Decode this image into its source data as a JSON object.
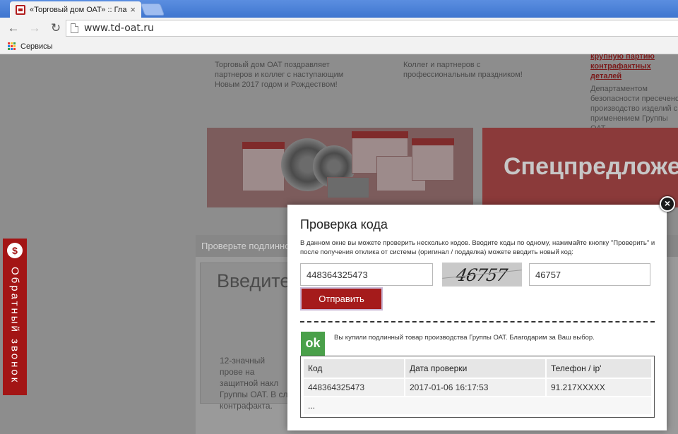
{
  "browser": {
    "tab_title": "«Торговый дом ОАТ» :: Гла",
    "tab_close": "×",
    "url": "www.td-oat.ru",
    "bookmarks_label": "Сервисы"
  },
  "background": {
    "news": [
      {
        "link": "",
        "text": "Торговый дом ОАТ поздравляет партнеров и коллег с наступающим Новым 2017 годом и Рождеством!"
      },
      {
        "link": "",
        "text": "Коллег и партнеров с профессиональным праздником!"
      },
      {
        "link": "крупную партию контрафактных деталей",
        "text": "Департаментом безопасности пресечено производство изделий с применением Группы ОАТ"
      }
    ],
    "banner_right_text": "Спецпредложе",
    "check_header": "Проверьте подлинность",
    "check_big": "Введите",
    "check_desc": "12-значный прове на защитной накл Группы ОАТ. В сл контрафакта."
  },
  "callback": {
    "icon": "$",
    "label": "Обратный звонок"
  },
  "modal": {
    "close_glyph": "×",
    "title": "Проверка кода",
    "description": "В данном окне вы можете проверить несколько кодов. Вводите коды по одному, нажимайте кнопку \"Проверить\" и после получения отклика от системы (оригинал / подделка) можете вводить новый код:",
    "code_value": "448364325473",
    "captcha_text": "46757",
    "captcha_value": "46757",
    "submit_label": "Отправить",
    "ok_label": "ok",
    "result_message": "Вы купили подлинный товар производства Группы ОАТ. Благодарим за Ваш выбор.",
    "table": {
      "headers": [
        "Код",
        "Дата проверки",
        "Телефон / ip'"
      ],
      "rows": [
        [
          "448364325473",
          "2017-01-06 16:17:53",
          "91.217XXXXX"
        ]
      ],
      "more": "..."
    }
  },
  "colors": {
    "accent_red": "#a51b1b",
    "ok_green": "#4aa04a"
  }
}
